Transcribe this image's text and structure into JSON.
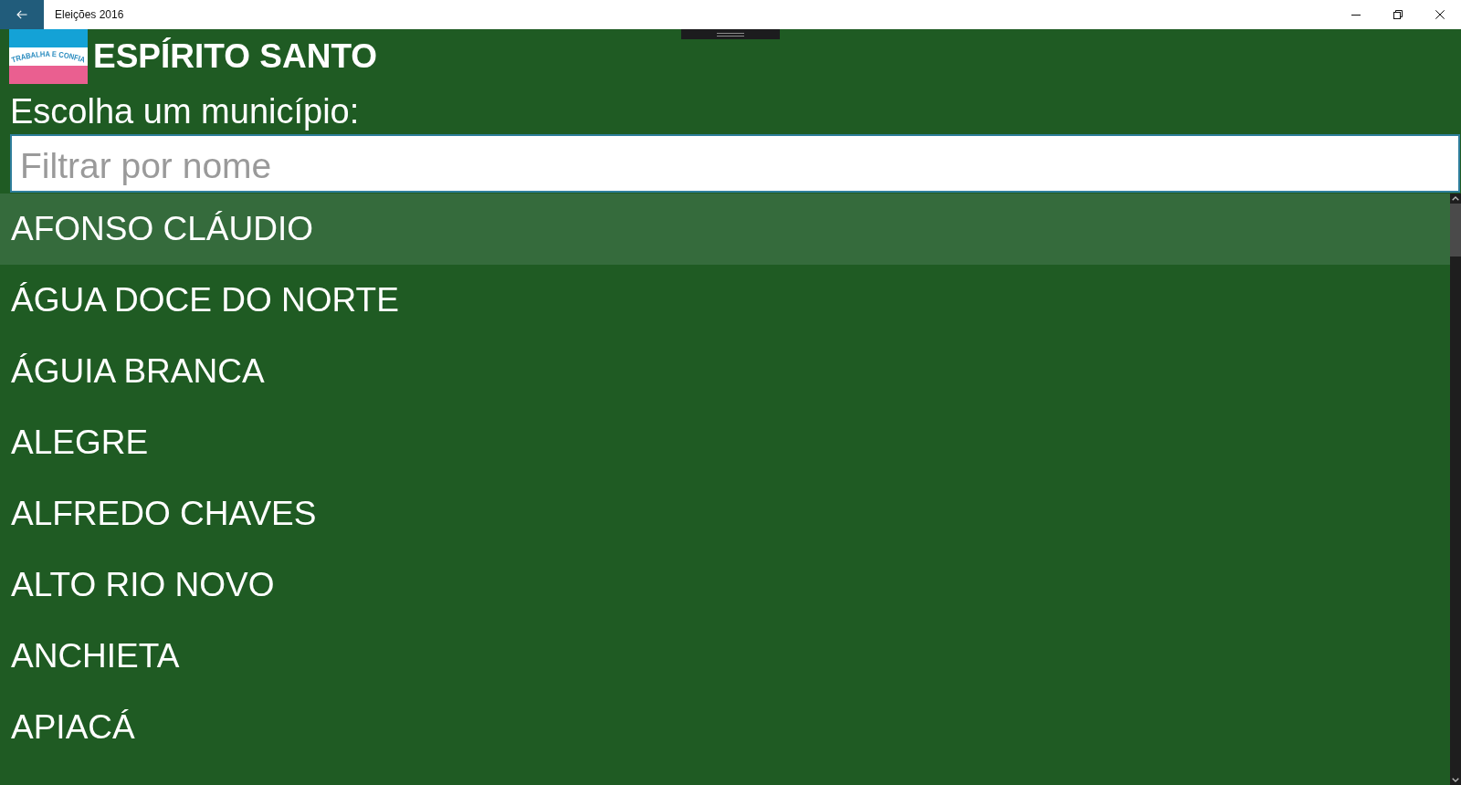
{
  "window": {
    "title": "Eleições 2016"
  },
  "header": {
    "flag": {
      "motto": "TRABALHA E CONFIA"
    },
    "title": "ESPÍRITO SANTO"
  },
  "prompt": "Escolha um município:",
  "search": {
    "placeholder": "Filtrar por nome"
  },
  "municipalities": [
    {
      "name": "AFONSO CLÁUDIO",
      "selected": true
    },
    {
      "name": "ÁGUA DOCE DO NORTE",
      "selected": false
    },
    {
      "name": "ÁGUIA BRANCA",
      "selected": false
    },
    {
      "name": "ALEGRE",
      "selected": false
    },
    {
      "name": "ALFREDO CHAVES",
      "selected": false
    },
    {
      "name": "ALTO RIO NOVO",
      "selected": false
    },
    {
      "name": "ANCHIETA",
      "selected": false
    },
    {
      "name": "APIACÁ",
      "selected": false
    }
  ]
}
